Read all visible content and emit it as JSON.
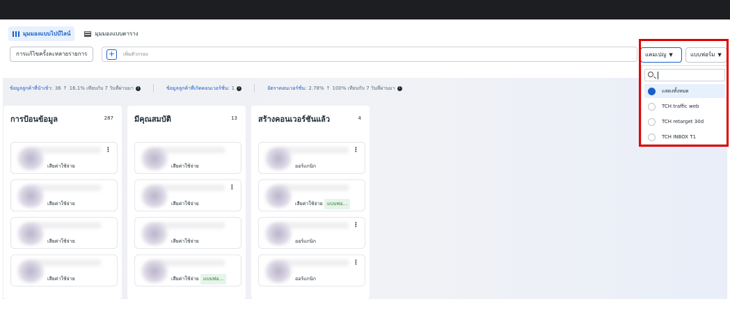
{
  "view_tabs": [
    {
      "label": "มุมมองแบบไปป์ไลน์",
      "icon": "pipeline-icon"
    },
    {
      "label": "มุมมองแบบตาราง",
      "icon": "table-icon"
    }
  ],
  "toolbar": {
    "bulk_edit_label": "การแก้ไขครั้งละหลายรายการ",
    "filter_placeholder": "เพิ่มตัวกรอง",
    "campaign_select": "แคมเปญ",
    "form_select": "แบบฟอร์ม"
  },
  "stats": [
    {
      "label": "ข้อมูลลูกค้าที่นำเข้า:",
      "value": "36",
      "change": "16.1% เทียบกับ 7 วันที่ผ่านมา"
    },
    {
      "label": "ข้อมูลลูกค้าที่เกิดคอนเวอร์ชั่น:",
      "value": "1",
      "change": ""
    },
    {
      "label": "อัตราคอนเวอร์ชั่น:",
      "value": "2.78%",
      "change": "100% เทียบกับ 7 วันที่ผ่านมา"
    }
  ],
  "columns": [
    {
      "title": "การป้อนข้อมูล",
      "count": "287",
      "cards": [
        {
          "tag": "เสียค่าใช้จ่าย",
          "tag2": ""
        },
        {
          "tag": "เสียค่าใช้จ่าย",
          "tag2": ""
        },
        {
          "tag": "เสียค่าใช้จ่าย",
          "tag2": ""
        },
        {
          "tag": "เสียค่าใช้จ่าย",
          "tag2": ""
        }
      ]
    },
    {
      "title": "มีคุณสมบัติ",
      "count": "13",
      "cards": [
        {
          "tag": "เสียค่าใช้จ่าย",
          "tag2": ""
        },
        {
          "tag": "เสียค่าใช้จ่าย",
          "tag2": ""
        },
        {
          "tag": "เสียค่าใช้จ่าย",
          "tag2": ""
        },
        {
          "tag": "เสียค่าใช้จ่าย",
          "tag2": "แบบฟอ..."
        }
      ]
    },
    {
      "title": "สร้างคอนเวอร์ชันแล้ว",
      "count": "4",
      "cards": [
        {
          "tag": "ออร์แกนิก",
          "tag2": ""
        },
        {
          "tag": "เสียค่าใช้จ่าย",
          "tag2": "แบบฟอ..."
        },
        {
          "tag": "ออร์แกนิก",
          "tag2": ""
        },
        {
          "tag": "ออร์แกนิก",
          "tag2": ""
        }
      ]
    }
  ],
  "dropdown": {
    "options": [
      "แสดงทั้งหมด",
      "TCH traffic web",
      "TCH retarget 30d",
      "TCH INBOX T1"
    ],
    "selected_index": 0
  }
}
